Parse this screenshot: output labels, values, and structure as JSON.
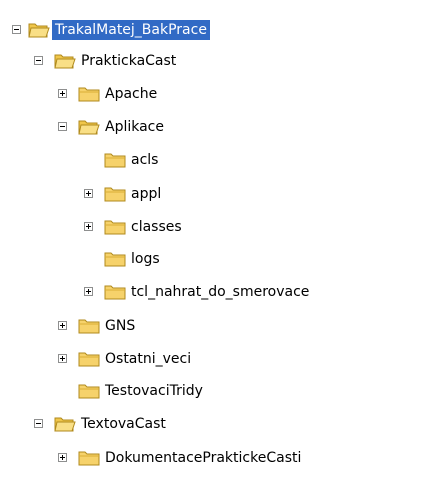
{
  "tree": {
    "nodes": [
      {
        "label": "TrakalMatej_BakPrace",
        "toggle": "minus",
        "selected": true
      },
      {
        "label": "PraktickaCast",
        "toggle": "minus"
      },
      {
        "label": "Apache",
        "toggle": "plus"
      },
      {
        "label": "Aplikace",
        "toggle": "minus"
      },
      {
        "label": "acls",
        "toggle": "none"
      },
      {
        "label": "appl",
        "toggle": "plus"
      },
      {
        "label": "classes",
        "toggle": "plus"
      },
      {
        "label": "logs",
        "toggle": "none"
      },
      {
        "label": "tcl_nahrat_do_smerovace",
        "toggle": "plus"
      },
      {
        "label": "GNS",
        "toggle": "plus"
      },
      {
        "label": "Ostatni_veci",
        "toggle": "plus"
      },
      {
        "label": "TestovaciTridy",
        "toggle": "none"
      },
      {
        "label": "TextovaCast",
        "toggle": "minus"
      },
      {
        "label": "DokumentacePraktickeCasti",
        "toggle": "plus"
      }
    ],
    "colors": {
      "selection": "#316ac5",
      "folder": "#f6d26b"
    }
  }
}
